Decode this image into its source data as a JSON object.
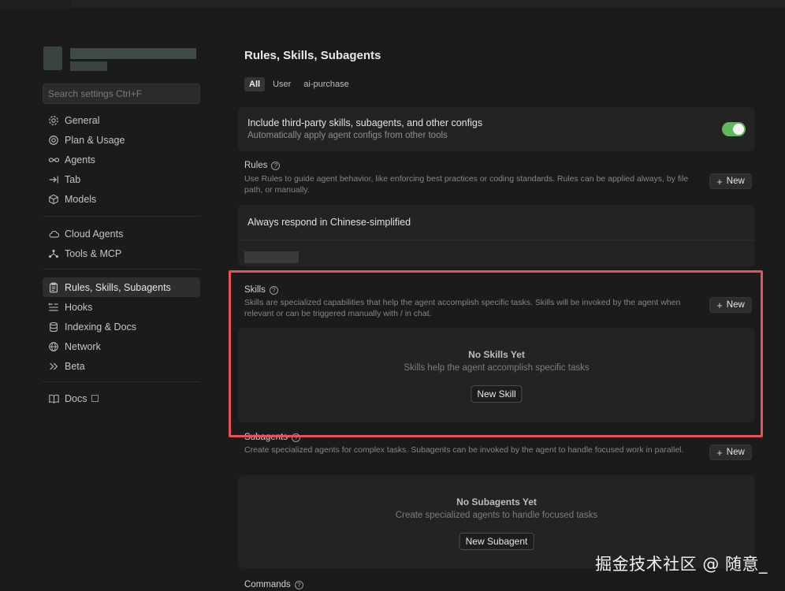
{
  "sidebar": {
    "search_placeholder": "Search settings Ctrl+F",
    "groups": [
      [
        {
          "label": "General",
          "icon": "gear-icon"
        },
        {
          "label": "Plan & Usage",
          "icon": "gauge-icon"
        },
        {
          "label": "Agents",
          "icon": "infinity-icon"
        },
        {
          "label": "Tab",
          "icon": "tab-arrow-icon"
        },
        {
          "label": "Models",
          "icon": "cube-icon"
        }
      ],
      [
        {
          "label": "Cloud Agents",
          "icon": "cloud-icon"
        },
        {
          "label": "Tools & MCP",
          "icon": "nodes-icon"
        }
      ],
      [
        {
          "label": "Rules, Skills, Subagents",
          "icon": "clipboard-icon",
          "active": true
        },
        {
          "label": "Hooks",
          "icon": "hooks-icon"
        },
        {
          "label": "Indexing & Docs",
          "icon": "database-icon"
        },
        {
          "label": "Network",
          "icon": "globe-icon"
        },
        {
          "label": "Beta",
          "icon": "chevrons-icon"
        }
      ]
    ],
    "docs_label": "Docs"
  },
  "main": {
    "title": "Rules, Skills, Subagents",
    "filters": [
      {
        "label": "All",
        "active": true
      },
      {
        "label": "User",
        "active": false
      },
      {
        "label": "ai-purchase",
        "active": false
      }
    ],
    "third_party": {
      "title": "Include third-party skills, subagents, and other configs",
      "subtitle": "Automatically apply agent configs from other tools",
      "enabled": true
    },
    "rules": {
      "title": "Rules",
      "description": "Use Rules to guide agent behavior, like enforcing best practices or coding standards. Rules can be applied always, by file path, or manually.",
      "new_label": "New",
      "items": [
        "Always respond in Chinese-simplified"
      ]
    },
    "skills": {
      "title": "Skills",
      "description": "Skills are specialized capabilities that help the agent accomplish specific tasks. Skills will be invoked by the agent when relevant or can be triggered manually with / in chat.",
      "new_label": "New",
      "empty_title": "No Skills Yet",
      "empty_subtitle": "Skills help the agent accomplish specific tasks",
      "empty_button": "New Skill"
    },
    "subagents": {
      "title": "Subagents",
      "description": "Create specialized agents for complex tasks. Subagents can be invoked by the agent to handle focused work in parallel.",
      "new_label": "New",
      "empty_title": "No Subagents Yet",
      "empty_subtitle": "Create specialized agents to handle focused tasks",
      "empty_button": "New Subagent"
    },
    "commands": {
      "title": "Commands"
    }
  },
  "watermark": "掘金技术社区 @ 随意_",
  "colors": {
    "background": "#1b1b1b",
    "card": "#232323",
    "toggle_on": "#5fb85c",
    "highlight": "#e25457"
  }
}
